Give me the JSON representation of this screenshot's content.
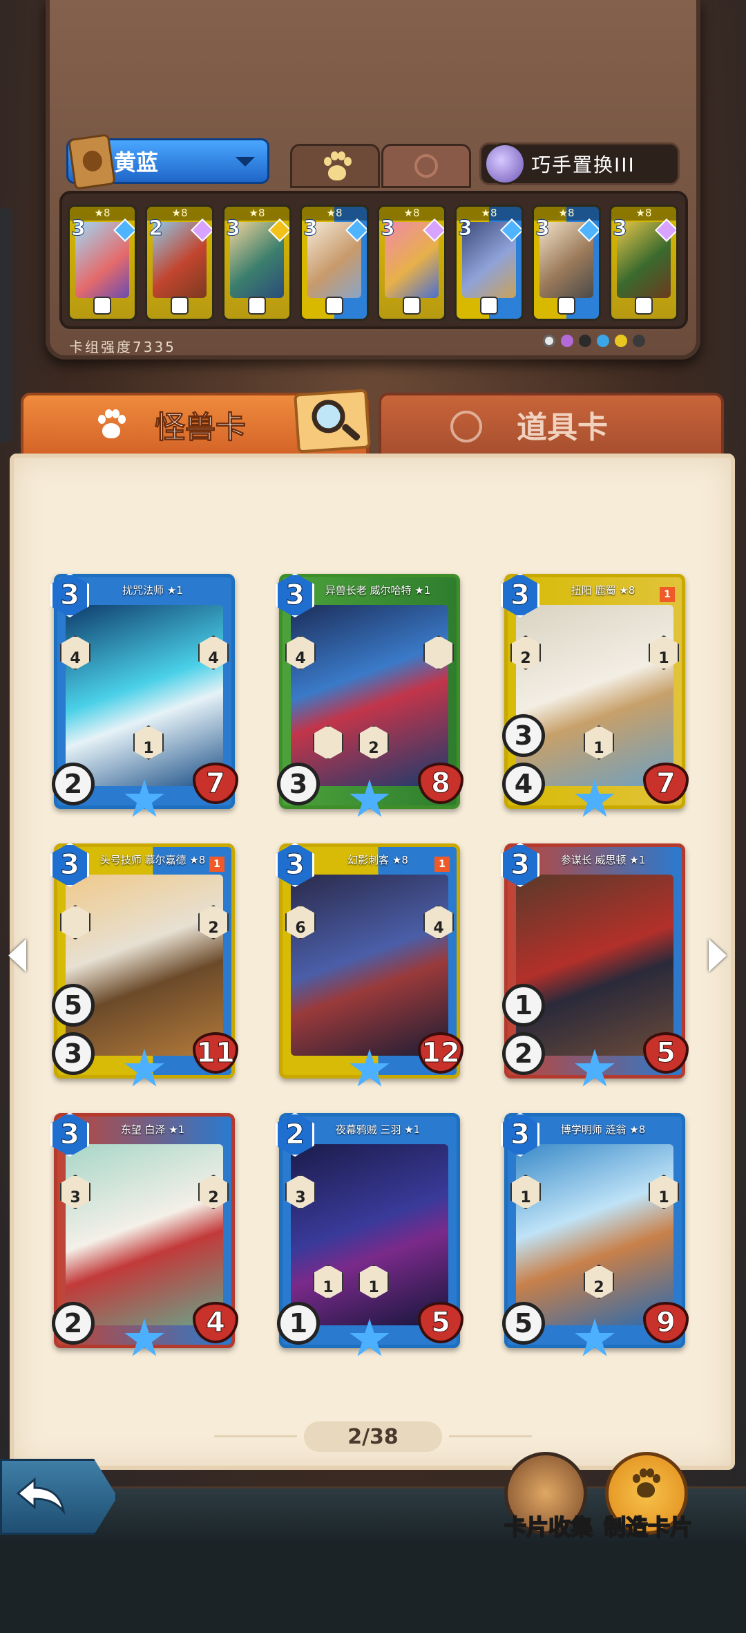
{
  "deck": {
    "name": "黄蓝",
    "swap_label": "巧手置换III",
    "power_label": "卡组强度7335",
    "cards": [
      {
        "cost": "3",
        "stars": "★8"
      },
      {
        "cost": "2",
        "stars": "★8"
      },
      {
        "cost": "3",
        "stars": "★8"
      },
      {
        "cost": "3",
        "stars": "★8"
      },
      {
        "cost": "3",
        "stars": "★8"
      },
      {
        "cost": "3",
        "stars": "★8"
      },
      {
        "cost": "3",
        "stars": "★8"
      },
      {
        "cost": "3",
        "stars": "★8"
      }
    ],
    "element_colors": [
      "#e8e8e8",
      "#b46ad8",
      "#2b2b2b",
      "#3aa6e6",
      "#e8c820",
      "#3a3a3a"
    ]
  },
  "tabs": {
    "monster": "怪兽卡",
    "item": "道具卡"
  },
  "cards": [
    {
      "name": "扰咒法师 ★1",
      "cost": "3",
      "left": "2",
      "right": "7",
      "hex": [
        "4",
        "4",
        "1"
      ],
      "flag": ""
    },
    {
      "name": "异兽长老 威尔哈特 ★1",
      "cost": "3",
      "left": "3",
      "right": "8",
      "hex": [
        "4",
        "",
        "",
        "2"
      ],
      "flag": ""
    },
    {
      "name": "扭阳 鹿蜀 ★8",
      "cost": "3",
      "left": "4",
      "right": "7",
      "hex": [
        "2",
        "1",
        "3",
        "1"
      ],
      "flag": "1"
    },
    {
      "name": "头号技师 慕尔嘉德 ★8",
      "cost": "3",
      "left": "3",
      "right": "11",
      "hex": [
        "",
        "2",
        "5"
      ],
      "flag": "1"
    },
    {
      "name": "幻影刺客 ★8",
      "cost": "3",
      "left": "",
      "right": "12",
      "hex": [
        "6",
        "4"
      ],
      "flag": "1"
    },
    {
      "name": "参谋长 威思顿 ★1",
      "cost": "3",
      "left": "2",
      "right": "5",
      "hex": [
        "",
        "",
        "1"
      ],
      "flag": ""
    },
    {
      "name": "东望 白泽 ★1",
      "cost": "3",
      "left": "2",
      "right": "4",
      "hex": [
        "3",
        "2"
      ],
      "flag": ""
    },
    {
      "name": "夜幕鸦贼 三羽 ★1",
      "cost": "2",
      "left": "1",
      "right": "5",
      "hex": [
        "3",
        "1",
        "1"
      ],
      "flag": ""
    },
    {
      "name": "博学明师 涟翁 ★8",
      "cost": "3",
      "left": "5",
      "right": "9",
      "hex": [
        "1",
        "1",
        "2"
      ],
      "flag": ""
    }
  ],
  "pager": "2/38",
  "bottom": {
    "collection": "卡片收集",
    "craft": "制造卡片"
  }
}
